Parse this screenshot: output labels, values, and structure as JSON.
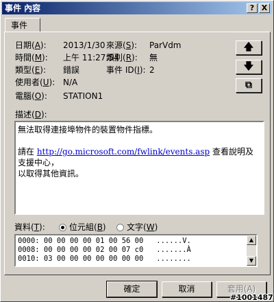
{
  "window": {
    "title": "事件 內容"
  },
  "titlebar_buttons": {
    "help": "?",
    "close": "X"
  },
  "tab": {
    "label": "事件"
  },
  "fields": {
    "date": {
      "label": "日期(",
      "key": "A",
      "suffix": "):",
      "value": "2013/1/30"
    },
    "time": {
      "label": "時間(",
      "key": "M",
      "suffix": "):",
      "value": "上午 11:27:54"
    },
    "type": {
      "label": "類型(",
      "key": "E",
      "suffix": "):",
      "value": "錯誤"
    },
    "user": {
      "label": "使用者(",
      "key": "U",
      "suffix": "):",
      "value": "N/A"
    },
    "computer": {
      "label": "電腦(",
      "key": "O",
      "suffix": "):",
      "value": "STATION1"
    },
    "source": {
      "label": "來源(",
      "key": "S",
      "suffix": "):",
      "value": "ParVdm"
    },
    "category": {
      "label": "類別(",
      "key": "R",
      "suffix": "):",
      "value": "無"
    },
    "event_id": {
      "label": "事件 ID(",
      "key": "I",
      "suffix": "):",
      "value": "2"
    }
  },
  "side_buttons": {
    "up": "🡅",
    "down": "🡇",
    "copy": "⧉"
  },
  "description": {
    "label": "描述(",
    "key": "D",
    "suffix": "):",
    "line1": "無法取得連接埠物件的裝置物件指標。",
    "line2_prefix": "請在 ",
    "link": "http://go.microsoft.com/fwlink/events.asp",
    "line2_suffix": " 查看說明及支援中心，",
    "line3": "以取得其他資訊。"
  },
  "data_section": {
    "label": "資料(",
    "key": "T",
    "suffix": "):",
    "radio_bytes": {
      "label": "位元組(",
      "key": "B",
      "suffix": ")",
      "selected": true
    },
    "radio_words": {
      "label": "文字(",
      "key": "W",
      "suffix": ")",
      "selected": false
    },
    "rows": [
      "0000: 00 00 00 00 01 00 56 00   ......V.",
      "0008: 00 00 00 00 02 00 07 c0   .......À",
      "0010: 03 00 00 00 00 00 00 00   ........"
    ]
  },
  "buttons": {
    "ok": "確定",
    "cancel": "取消",
    "apply": "套用(A)"
  },
  "watermark": "#1001487"
}
